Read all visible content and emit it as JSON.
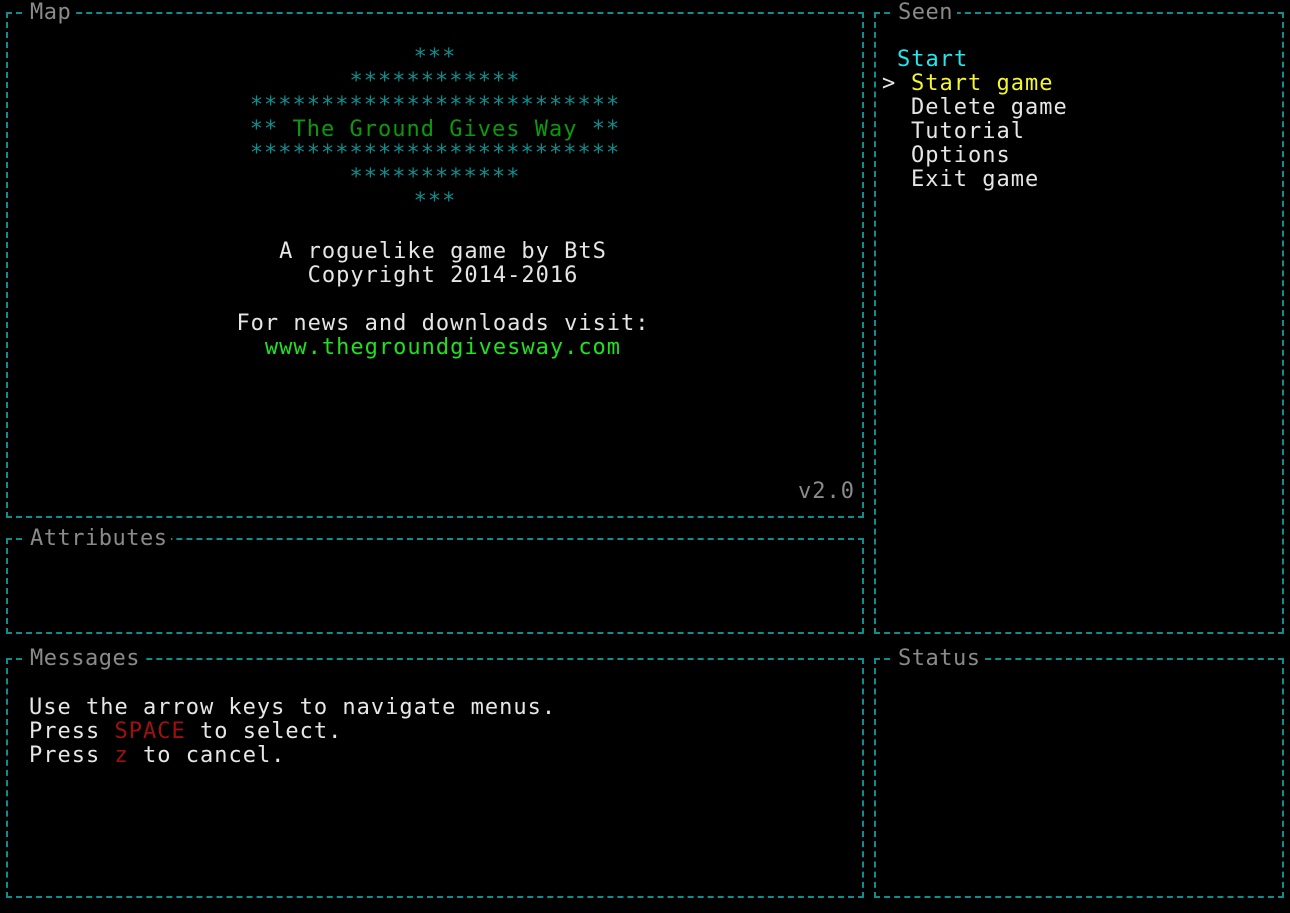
{
  "panels": {
    "map_title": "Map",
    "seen_title": "Seen",
    "attributes_title": "Attributes",
    "messages_title": "Messages",
    "status_title": "Status"
  },
  "banner": {
    "stars_1": "***",
    "stars_2": "************",
    "stars_3": "**************************",
    "title_prefix": "** ",
    "title": "The Ground Gives Way",
    "title_suffix": " **",
    "stars_4": "**************************",
    "stars_5": "************",
    "stars_6": "***"
  },
  "credits": {
    "line1": "A roguelike game by BtS",
    "line2": "Copyright 2014-2016",
    "line3": "For news and downloads visit:",
    "url": "www.thegroundgivesway.com"
  },
  "version": "v2.0",
  "menu": {
    "heading": "Start",
    "cursor": ">",
    "items": [
      {
        "label": "Start game"
      },
      {
        "label": "Delete game"
      },
      {
        "label": "Tutorial"
      },
      {
        "label": "Options"
      },
      {
        "label": "Exit game"
      }
    ]
  },
  "messages": {
    "line1": "Use the arrow keys to navigate menus.",
    "press": "Press ",
    "space_key": "SPACE",
    "to_select": " to select.",
    "z_key": "z",
    "to_cancel": " to cancel."
  },
  "colors": {
    "border": "#0d8f8f",
    "title_gray": "#8a8a8a",
    "banner_green": "#0a9a0a",
    "url_green": "#20e020",
    "heading_cyan": "#20e8f0",
    "selected_yellow": "#f5f530",
    "key_red": "#a01010"
  }
}
